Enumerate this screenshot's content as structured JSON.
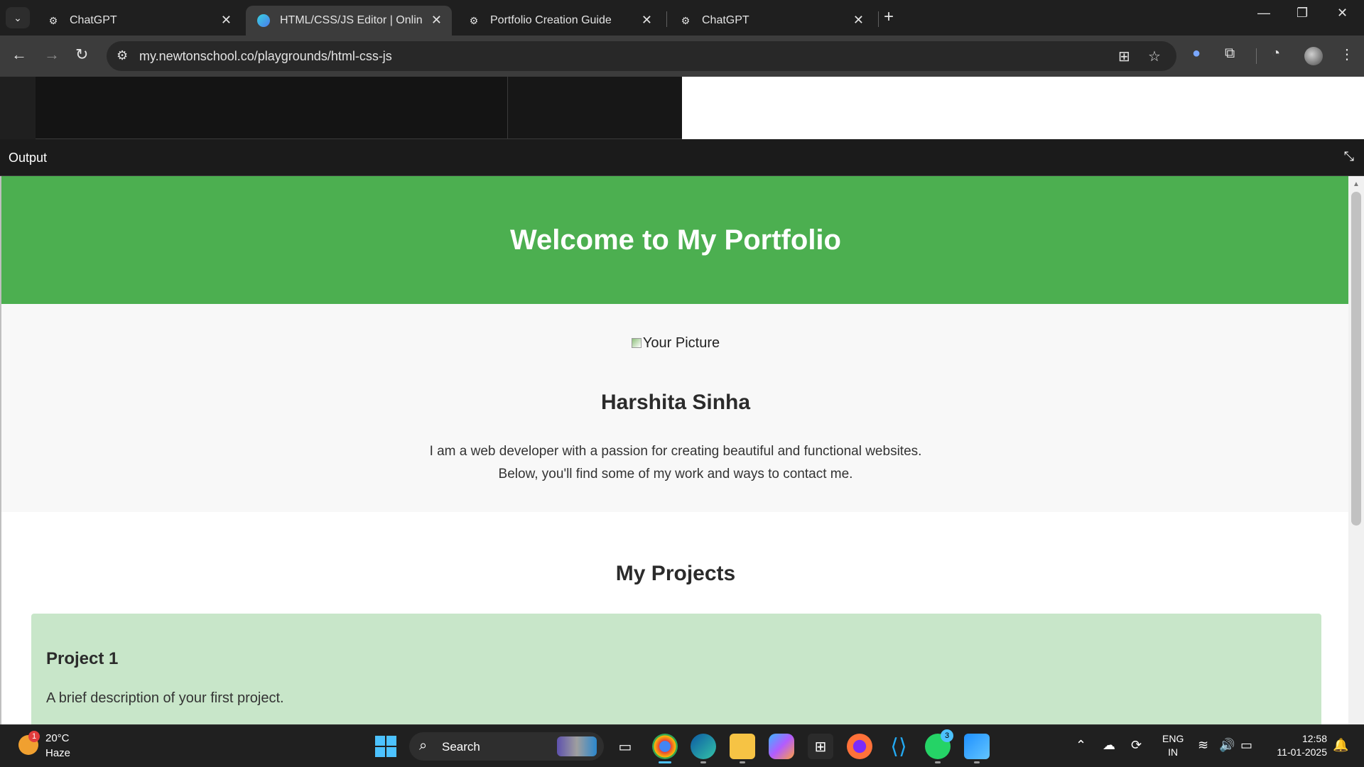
{
  "browser": {
    "tabs": [
      {
        "title": "ChatGPT",
        "active": false
      },
      {
        "title": "HTML/CSS/JS Editor | Online Co",
        "active": true
      },
      {
        "title": "Portfolio Creation Guide",
        "active": false
      },
      {
        "title": "ChatGPT",
        "active": false
      }
    ],
    "url": "my.newtonschool.co/playgrounds/html-css-js",
    "icons": {
      "tab_search": "chevron-down-icon",
      "new_tab": "plus-icon",
      "minimize": "minimize-icon",
      "restore": "restore-icon",
      "close": "close-icon",
      "back": "back-arrow-icon",
      "forward": "forward-arrow-icon",
      "reload": "reload-icon",
      "site_info": "site-settings-icon",
      "translate": "translate-icon",
      "bookmark": "star-icon",
      "extensions": "puzzle-icon"
    }
  },
  "editor": {
    "output_label": "Output",
    "collapse_icon": "collapse-icon"
  },
  "preview": {
    "header_title": "Welcome to My Portfolio",
    "picture_alt": "Your Picture",
    "name": "Harshita Sinha",
    "bio_line1": "I am a web developer with a passion for creating beautiful and functional websites.",
    "bio_line2": "Below, you'll find some of my work and ways to contact me.",
    "projects_heading": "My Projects",
    "project1_title": "Project 1",
    "project1_desc": "A brief description of your first project.",
    "colors": {
      "header_bg": "#4caf50",
      "about_bg": "#f8f8f8",
      "project_bg": "#c8e6c9"
    }
  },
  "taskbar": {
    "weather_temp": "20°C",
    "weather_desc": "Haze",
    "weather_badge": "1",
    "search_label": "Search",
    "apps": [
      "task-view",
      "chrome",
      "edge",
      "file-explorer",
      "copilot",
      "microsoft-store",
      "firefox",
      "vscode",
      "whatsapp",
      "photos"
    ],
    "whatsapp_badge": "3",
    "lang_line1": "ENG",
    "lang_line2": "IN",
    "time": "12:58",
    "date": "11-01-2025"
  }
}
